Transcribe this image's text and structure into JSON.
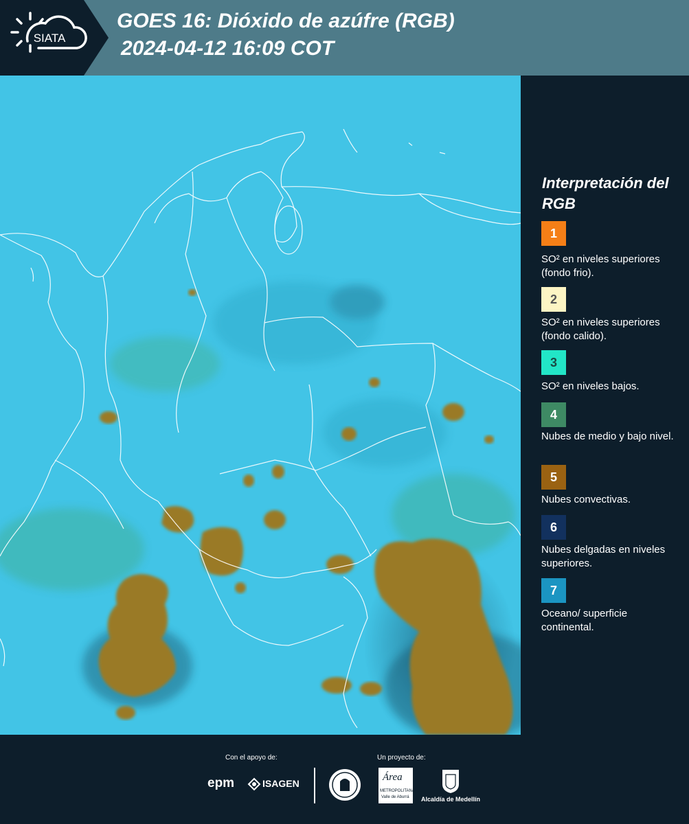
{
  "header": {
    "title_line1": "GOES 16: Dióxido de azúfre (RGB)",
    "title_line2": " 2024-04-12 16:09 COT",
    "logo_text": "SIATA",
    "background": "#4e7b89",
    "logo_background": "#0d1e2b"
  },
  "map": {
    "background_color": "#42c4e6",
    "border_color": "#ffffff",
    "convective_color": "#9a7a28"
  },
  "legend": {
    "title": "Interpretación del RGB",
    "items": [
      {
        "number": "1",
        "color": "#f57f17",
        "text_color": "#ffffff",
        "label": "SO² en niveles superiores (fondo frio)."
      },
      {
        "number": "2",
        "color": "#fdf5c4",
        "text_color": "#555555",
        "label": "SO² en niveles superiores (fondo calido)."
      },
      {
        "number": "3",
        "color": "#22e6c7",
        "text_color": "#1a4a44",
        "label": "SO² en niveles bajos."
      },
      {
        "number": "4",
        "color": "#3e8a64",
        "text_color": "#ffffff",
        "label": "Nubes de medio y bajo nivel."
      },
      {
        "number": "5",
        "color": "#9a6212",
        "text_color": "#ffffff",
        "label": "Nubes convectivas."
      },
      {
        "number": "6",
        "color": "#12315e",
        "text_color": "#ffffff",
        "label": "Nubes delgadas en niveles superiores."
      },
      {
        "number": "7",
        "color": "#1b95c2",
        "text_color": "#ffffff",
        "label": "Oceano/ superficie continental."
      }
    ]
  },
  "footer": {
    "support_label": "Con el apoyo de:",
    "project_label": "Un proyecto de:",
    "epm_text": "epm",
    "isagen_text": "ISAGEN",
    "area_text": "Área",
    "area_subtext": "METROPOLITANA",
    "area_subtext2": "Valle de Aburrá",
    "medellin_text": "Alcaldía de Medellín"
  }
}
